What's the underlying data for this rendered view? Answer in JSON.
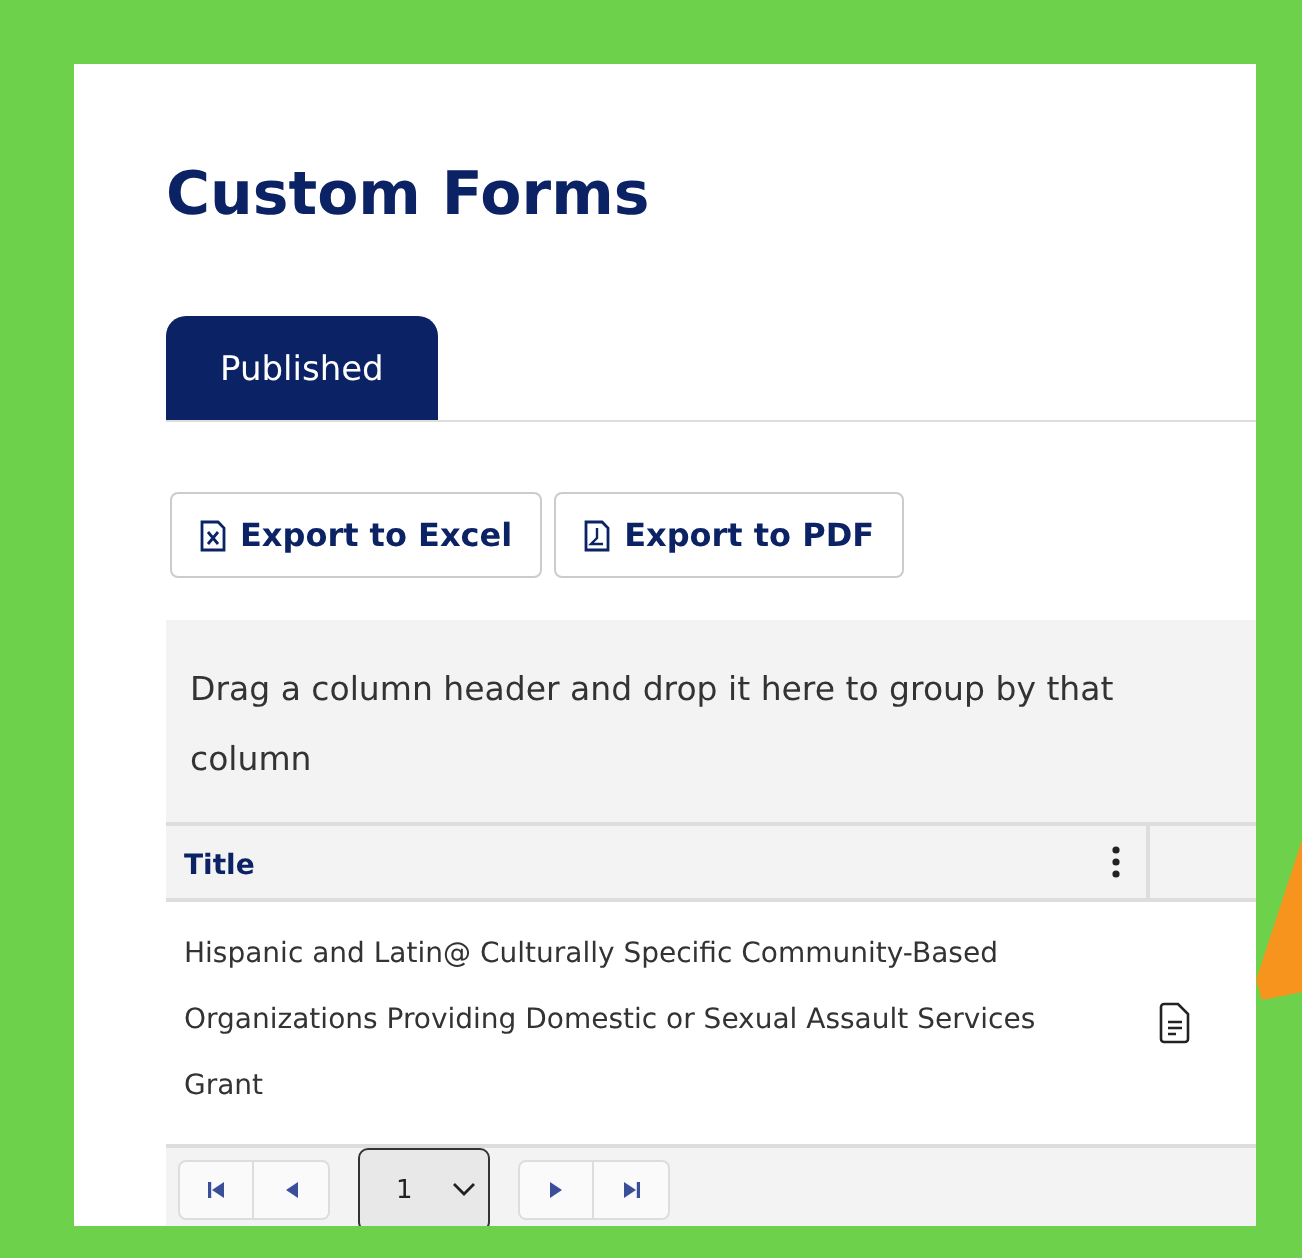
{
  "page": {
    "title": "Custom Forms"
  },
  "tabs": [
    {
      "label": "Published",
      "selected": true
    }
  ],
  "toolbar": {
    "buttons": [
      {
        "kind": "excel",
        "label": "Export to Excel"
      },
      {
        "kind": "pdf",
        "label": "Export to PDF"
      }
    ]
  },
  "group_panel": {
    "text": "Drag a column header and drop it here to group by that column"
  },
  "table": {
    "columns": [
      {
        "label": "Title"
      }
    ],
    "rows": [
      {
        "title": "Hispanic and Latin@ Culturally Specific Community-Based Organizations Providing Domestic or Sexual Assault Services Grant"
      }
    ]
  },
  "pager": {
    "page": "1"
  }
}
